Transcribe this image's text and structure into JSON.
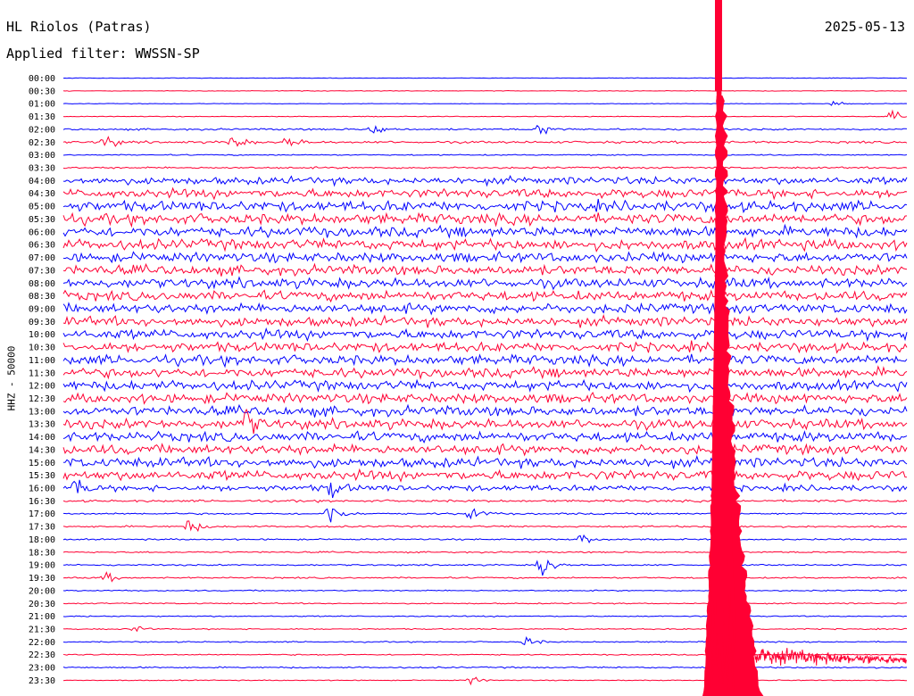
{
  "header": {
    "station": "HL Riolos (Patras)",
    "filter": "Applied filter: WWSSN-SP",
    "date": "2025-05-13",
    "channel": "HHZ - 50000"
  },
  "colors": {
    "even_rows": "#0000ff",
    "odd_rows": "#ff0033"
  },
  "chart_data": {
    "type": "line",
    "title": "HL Riolos (Patras)",
    "subtitle": "Applied filter: WWSSN-SP",
    "date": "2025-05-13",
    "ylabel": "HHZ - 50000",
    "xlabel": "",
    "rows": [
      "00:00",
      "00:30",
      "01:00",
      "01:30",
      "02:00",
      "02:30",
      "03:00",
      "03:30",
      "04:00",
      "04:30",
      "05:00",
      "05:30",
      "06:00",
      "06:30",
      "07:00",
      "07:30",
      "08:00",
      "08:30",
      "09:00",
      "09:30",
      "10:00",
      "10:30",
      "11:00",
      "11:30",
      "12:00",
      "12:30",
      "13:00",
      "13:30",
      "14:00",
      "14:30",
      "15:00",
      "15:30",
      "16:00",
      "16:30",
      "17:00",
      "17:30",
      "18:00",
      "18:30",
      "19:00",
      "19:30",
      "20:00",
      "20:30",
      "21:00",
      "21:30",
      "22:00",
      "22:30",
      "23:00",
      "23:30"
    ],
    "row_minutes": 30,
    "noise_level": [
      0.4,
      0.4,
      0.4,
      0.5,
      1.2,
      1.5,
      0.8,
      1.2,
      5,
      6,
      7,
      7,
      7,
      7,
      6.5,
      6.5,
      6.5,
      6.5,
      6.5,
      6.5,
      6.5,
      6.5,
      6.5,
      6.5,
      6.5,
      6.5,
      6.5,
      6.5,
      6.5,
      6.5,
      6.5,
      6.5,
      4,
      1.5,
      1.2,
      1.2,
      1,
      1,
      1,
      1,
      0.8,
      0.8,
      0.8,
      0.8,
      0.8,
      0.8,
      1,
      0.6
    ],
    "events": [
      {
        "row": "01:00",
        "minute": 27.5,
        "amplitude": 5
      },
      {
        "row": "01:30",
        "minute": 29.5,
        "amplitude": 8
      },
      {
        "row": "02:00",
        "minute": 11,
        "amplitude": 12
      },
      {
        "row": "02:00",
        "minute": 17,
        "amplitude": 10
      },
      {
        "row": "02:30",
        "minute": 1.5,
        "amplitude": 12
      },
      {
        "row": "02:30",
        "minute": 6,
        "amplitude": 12
      },
      {
        "row": "02:30",
        "minute": 8,
        "amplitude": 10
      },
      {
        "row": "13:30",
        "minute": 6.5,
        "amplitude": 22
      },
      {
        "row": "16:00",
        "minute": 0.5,
        "amplitude": 12
      },
      {
        "row": "16:00",
        "minute": 9.5,
        "amplitude": 15
      },
      {
        "row": "17:00",
        "minute": 9.5,
        "amplitude": 18
      },
      {
        "row": "17:00",
        "minute": 14.5,
        "amplitude": 14
      },
      {
        "row": "17:30",
        "minute": 4.5,
        "amplitude": 12
      },
      {
        "row": "18:00",
        "minute": 18.5,
        "amplitude": 9
      },
      {
        "row": "19:00",
        "minute": 17,
        "amplitude": 25
      },
      {
        "row": "19:30",
        "minute": 1.5,
        "amplitude": 8
      },
      {
        "row": "21:30",
        "minute": 2.5,
        "amplitude": 7
      },
      {
        "row": "22:00",
        "minute": 16.5,
        "amplitude": 8
      },
      {
        "row": "23:30",
        "minute": 14.5,
        "amplitude": 6
      }
    ],
    "mainshock": {
      "row": "00:00",
      "minute": 23.3,
      "peak_amplitude": "off-scale",
      "coda_until_row": "23:30"
    },
    "xlim_minutes": [
      0,
      30
    ],
    "grid": false,
    "legend": "none"
  }
}
